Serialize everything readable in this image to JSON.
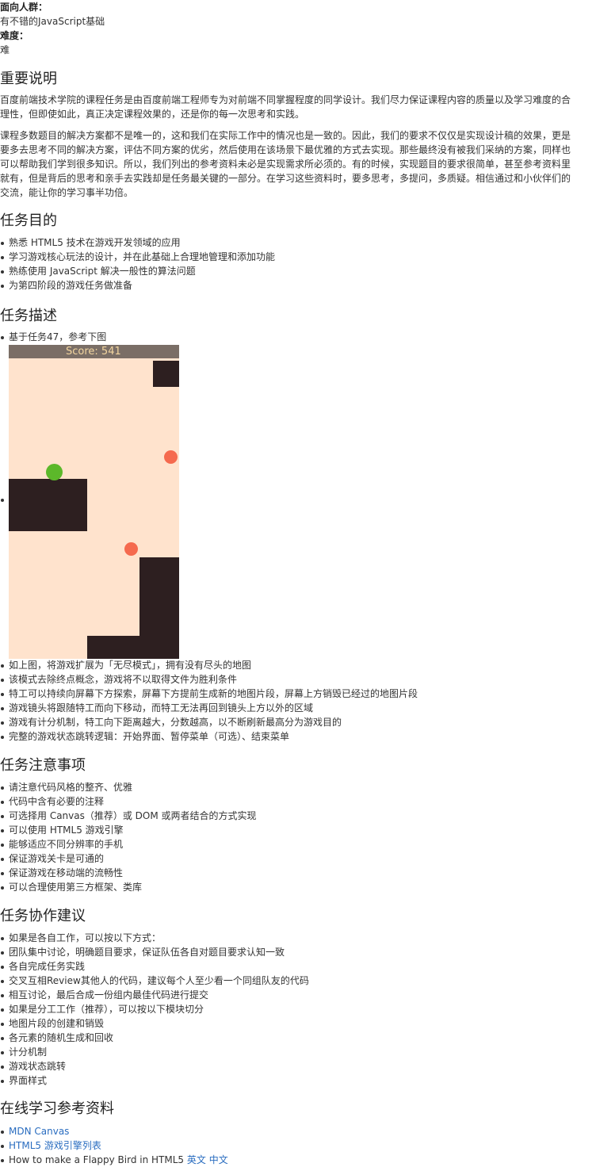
{
  "meta": {
    "audience_label": "面向人群：",
    "audience_value": "有不错的JavaScript基础",
    "difficulty_label": "难度：",
    "difficulty_value": "难"
  },
  "important": {
    "title": "重要说明",
    "p1_l1": "百度前端技术学院的课程任务是由百度前端工程师专为对前端不同掌握程度的同学设计。我们尽力保证课程内容的质量以及学习难度的合",
    "p1_l2": "理性，但即使如此，真正决定课程效果的，还是你的每一次思考和实践。",
    "p2_l1": "课程多数题目的解决方案都不是唯一的，这和我们在实际工作中的情况也是一致的。因此，我们的要求不仅仅是实现设计稿的效果，更是",
    "p2_l2": "要多去思考不同的解决方案，评估不同方案的优劣，然后使用在该场景下最优雅的方式去实现。那些最终没有被我们采纳的方案，同样也",
    "p2_l3": "可以帮助我们学到很多知识。所以，我们列出的参考资料未必是实现需求所必须的。有的时候，实现题目的要求很简单，甚至参考资料里",
    "p2_l4": "就有，但是背后的思考和亲手去实践却是任务最关键的一部分。在学习这些资料时，要多思考，多提问，多质疑。相信通过和小伙伴们的",
    "p2_l5": "交流，能让你的学习事半功倍。"
  },
  "goals": {
    "title": "任务目的",
    "items": [
      "熟悉 HTML5 技术在游戏开发领域的应用",
      "学习游戏核心玩法的设计，并在此基础上合理地管理和添加功能",
      "熟练使用 JavaScript 解决一般性的算法问题",
      "为第四阶段的游戏任务做准备"
    ]
  },
  "desc": {
    "title": "任务描述",
    "first_item": "基于任务47，参考下图",
    "game_score": "Score: 541",
    "items": [
      "如上图，将游戏扩展为「无尽模式」，拥有没有尽头的地图",
      "该模式去除终点概念，游戏将不以取得文件为胜利条件",
      "特工可以持续向屏幕下方探索，屏幕下方提前生成新的地图片段，屏幕上方销毁已经过的地图片段",
      "游戏镜头将跟随特工而向下移动，而特工无法再回到镜头上方以外的区域",
      "游戏有计分机制，特工向下距离越大，分数越高，以不断刷新最高分为游戏目的",
      "完整的游戏状态跳转逻辑：开始界面、暂停菜单（可选）、结束菜单"
    ]
  },
  "notes": {
    "title": "任务注意事项",
    "items": [
      "请注意代码风格的整齐、优雅",
      "代码中含有必要的注释",
      "可选择用 Canvas（推荐）或 DOM 或两者结合的方式实现",
      "可以使用 HTML5 游戏引擎",
      "能够适应不同分辨率的手机",
      "保证游戏关卡是可通的",
      "保证游戏在移动端的流畅性",
      "可以合理使用第三方框架、类库"
    ]
  },
  "collab": {
    "title": "任务协作建议",
    "items": [
      "如果是各自工作，可以按以下方式：",
      "团队集中讨论，明确题目要求，保证队伍各自对题目要求认知一致",
      "各自完成任务实践",
      "交叉互相Review其他人的代码，建议每个人至少看一个同组队友的代码",
      "相互讨论，最后合成一份组内最佳代码进行提交",
      "如果是分工工作（推荐），可以按以下模块切分",
      "地图片段的创建和销毁",
      "各元素的随机生成和回收",
      "计分机制",
      "游戏状态跳转",
      "界面样式"
    ]
  },
  "refs": {
    "title": "在线学习参考资料",
    "link1": "MDN Canvas",
    "link2": "HTML5 游戏引擎列表",
    "item3_text": "How to make a Flappy Bird in HTML5 ",
    "link3a": "英文",
    "link3b": "中文"
  },
  "colors": {
    "game_bg": "#ffe3cd",
    "block": "#2d1f20",
    "player": "#5cb82a",
    "enemy": "#f56a4e",
    "score_bar": "#7a6e66",
    "link": "#2a6dc0"
  }
}
